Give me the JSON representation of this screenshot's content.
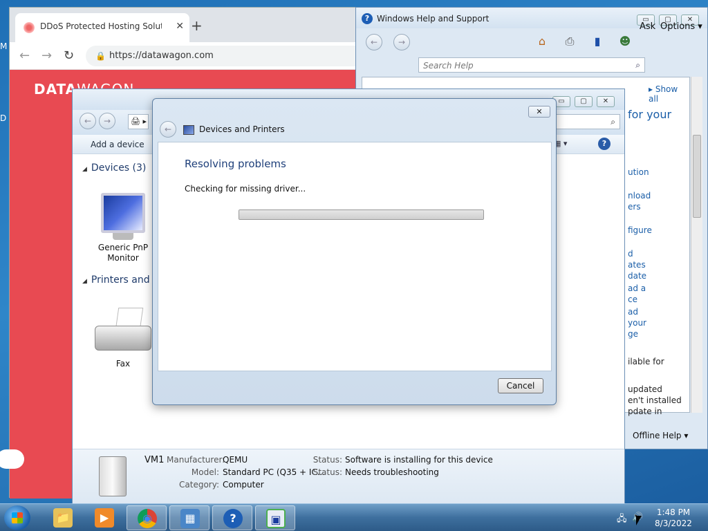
{
  "desktop": {
    "label_m": "M",
    "label_d": "D"
  },
  "chrome": {
    "tab_title": "DDoS Protected Hosting Solution",
    "tab_close": "✕",
    "new_tab": "+",
    "back": "←",
    "forward": "→",
    "reload": "↻",
    "lock": "🔒",
    "url": "https://datawagon.com",
    "logo_bold": "DATA",
    "logo_thin": "WAGON",
    "site_color": "#e84a52"
  },
  "help": {
    "title": "Windows Help and Support",
    "minimize": "▭",
    "maximize": "▢",
    "close": "✕",
    "ask_label": "Ask",
    "options_label": "Options ▾",
    "search_placeholder": "Search Help",
    "show_all": "▸ Show all",
    "heading": "for your",
    "links": [
      "ution",
      "nload",
      "ers",
      "figure",
      "d",
      "ates",
      "date",
      "ad a",
      "ce",
      "ad",
      "your",
      "ge"
    ],
    "texts": [
      "ilable for",
      "updated",
      "en't installed",
      "pdate in"
    ],
    "offline_help": "Offline Help ▾",
    "icons": [
      "home-icon",
      "print-icon",
      "browse-icon",
      "ask-icon"
    ]
  },
  "devices": {
    "address_glyph": "🖨 ▸",
    "add_device": "Add a device",
    "help_glyph": "?",
    "view_glyph": "▦ ▾",
    "devices_header": "Devices (3)",
    "printers_header": "Printers and F",
    "items": [
      {
        "label": "Generic PnP Monitor"
      },
      {
        "label": "Fax"
      }
    ],
    "details": {
      "name": "VM1",
      "manufacturer_label": "Manufacturer:",
      "manufacturer": "QEMU",
      "model_label": "Model:",
      "model": "Standard PC (Q35 + IC...",
      "category_label": "Category:",
      "category": "Computer",
      "status_label_1": "Status:",
      "status_1": "Software is installing for this device",
      "status_label_2": "Status:",
      "status_2": "Needs troubleshooting"
    }
  },
  "dialog": {
    "close": "✕",
    "back": "←",
    "title": "Devices and Printers",
    "heading": "Resolving problems",
    "status": "Checking for missing driver...",
    "progress": 1.0,
    "cancel": "Cancel"
  },
  "taskbar": {
    "items": [
      {
        "name": "explorer",
        "glyph": "📁"
      },
      {
        "name": "media-player",
        "glyph": "▶"
      },
      {
        "name": "chrome",
        "glyph": "◉"
      },
      {
        "name": "control-panel",
        "glyph": "▦"
      },
      {
        "name": "help",
        "glyph": "?"
      },
      {
        "name": "devices",
        "glyph": "▣"
      }
    ],
    "tray_network": "🖧",
    "tray_volume": "🔊",
    "time": "1:48 PM",
    "date": "8/3/2022"
  }
}
